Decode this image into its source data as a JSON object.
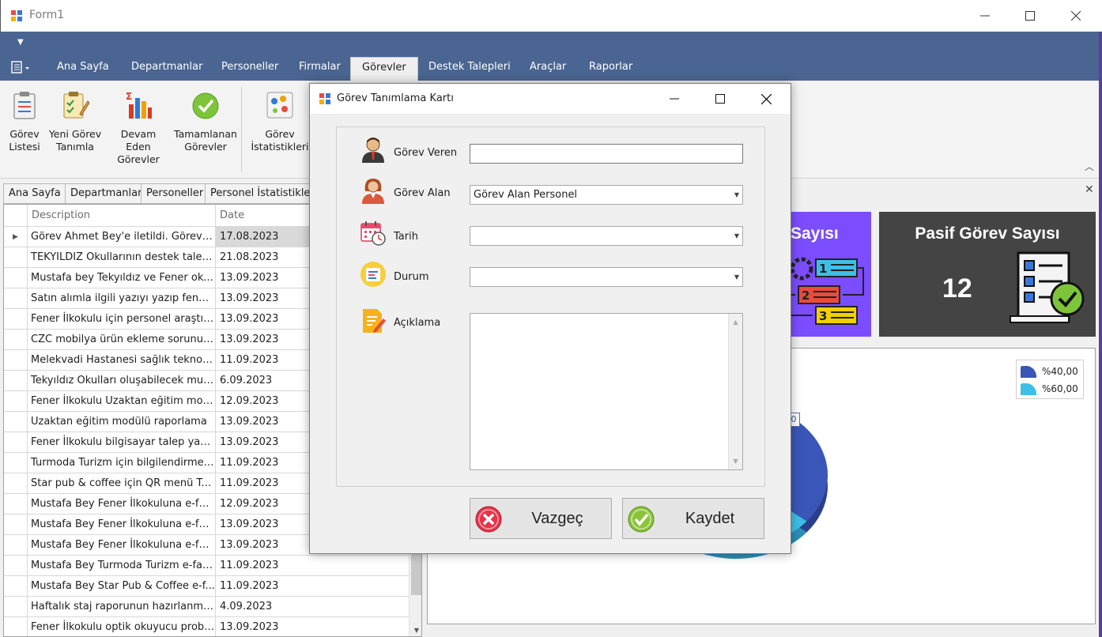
{
  "window": {
    "title": "Form1"
  },
  "ribbon": {
    "tabs": [
      {
        "label": "Ana Sayfa"
      },
      {
        "label": "Departmanlar"
      },
      {
        "label": "Personeller"
      },
      {
        "label": "Firmalar"
      },
      {
        "label": "Görevler"
      },
      {
        "label": "Destek Talepleri"
      },
      {
        "label": "Araçlar"
      },
      {
        "label": "Raporlar"
      }
    ],
    "buttons": [
      {
        "label": "Görev Listesi",
        "line1": "Görev",
        "line2": "Listesi"
      },
      {
        "label": "Yeni Görev Tanımla",
        "line1": "Yeni Görev",
        "line2": "Tanımla"
      },
      {
        "label": "Devam Eden Görevler",
        "line1": "Devam Eden",
        "line2": "Görevler"
      },
      {
        "label": "Tamamlanan Görevler",
        "line1": "Tamamlanan",
        "line2": "Görevler"
      },
      {
        "label": "Görev İstatistikleri",
        "line1": "Görev",
        "line2": "İstatistikleri"
      }
    ]
  },
  "doc_tabs": [
    {
      "label": "Ana Sayfa"
    },
    {
      "label": "Departmanlar"
    },
    {
      "label": "Personeller"
    },
    {
      "label": "Personel İstatistikleri"
    }
  ],
  "grid": {
    "columns": [
      "Description",
      "Date"
    ],
    "rows": [
      {
        "description": "Görev Ahmet Bey'e iletildi. Görev nu...",
        "date": "17.08.2023"
      },
      {
        "description": "TEKYILDIZ Okullarının destek talebi ç...",
        "date": "21.08.2023"
      },
      {
        "description": "Mustafa bey Tekyıldız ve Fener okull...",
        "date": "13.09.2023"
      },
      {
        "description": "Satın alımla ilgili yazıyı yazıp fener ilk...",
        "date": "13.09.2023"
      },
      {
        "description": "Fener İlkokulu için personel araştırm...",
        "date": "13.09.2023"
      },
      {
        "description": "CZC mobilya ürün ekleme sorunuyla ...",
        "date": "13.09.2023"
      },
      {
        "description": "Melekvadi Hastanesi sağlık teknolojil...",
        "date": "11.09.2023"
      },
      {
        "description": "Tekyıldız Okulları oluşabilecek muhte...",
        "date": "6.09.2023"
      },
      {
        "description": "Fener İlkokulu Uzaktan eğitim modül...",
        "date": "12.09.2023"
      },
      {
        "description": "Uzaktan eğitim modülü raporlama",
        "date": "13.09.2023"
      },
      {
        "description": "Fener İlkokulu bilgisayar talep yazısı",
        "date": "13.09.2023"
      },
      {
        "description": "Turmoda Turizm için bilgilendirme ve ...",
        "date": "11.09.2023"
      },
      {
        "description": "Star pub & coffee için QR menü Tas...",
        "date": "11.09.2023"
      },
      {
        "description": "Mustafa Bey Fener İlkokuluna e-fat...",
        "date": "12.09.2023"
      },
      {
        "description": "Mustafa Bey Fener İlkokuluna e-fat...",
        "date": "13.09.2023"
      },
      {
        "description": "Mustafa Bey Fener İlkokuluna e-fat...",
        "date": "13.09.2023"
      },
      {
        "description": "Mustafa Bey Turmoda Turizm e-fatu...",
        "date": "11.09.2023"
      },
      {
        "description": " Mustafa Bey Star Pub & Coffee e-f...",
        "date": "11.09.2023"
      },
      {
        "description": "Haftalık staj raporunun hazırlanması",
        "date": "4.09.2023"
      },
      {
        "description": "Fener İlkokulu optik okuyucu proble...",
        "date": "13.09.2023"
      }
    ]
  },
  "cards": {
    "active_title": "Sayısı",
    "passive_title": "Pasif Görev Sayısı",
    "passive_value": "12"
  },
  "chart_data": {
    "type": "pie",
    "legend": [
      "%40,00",
      "%60,00"
    ],
    "values": [
      40,
      60
    ],
    "colors": [
      "#3a56b8",
      "#3dbfe8"
    ],
    "label_fragment": "0"
  },
  "dialog": {
    "title": "Görev Tanımlama Kartı",
    "fields": {
      "veren": {
        "label": "Görev Veren",
        "value": ""
      },
      "alan": {
        "label": "Görev Alan",
        "value": "Görev Alan Personel"
      },
      "tarih": {
        "label": "Tarih",
        "value": ""
      },
      "durum": {
        "label": "Durum",
        "value": ""
      },
      "aciklama": {
        "label": "Açıklama",
        "value": ""
      }
    },
    "cancel_label": "Vazgeç",
    "save_label": "Kaydet"
  }
}
